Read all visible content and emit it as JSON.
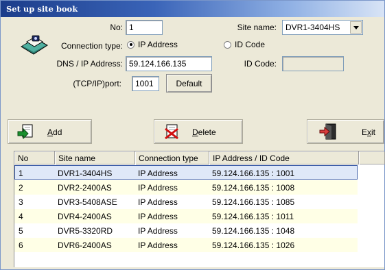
{
  "window": {
    "title": "Set up site book"
  },
  "form": {
    "no_label": "No:",
    "no_value": "1",
    "site_name_label": "Site name:",
    "site_name_value": "DVR1-3404HS",
    "connection_type_label": "Connection type:",
    "radio_ip_label": "IP Address",
    "radio_id_label": "ID Code",
    "selected_connection": "IP Address",
    "dns_ip_label": "DNS / IP Address:",
    "dns_ip_value": "59.124.166.135",
    "id_code_label": "ID Code:",
    "id_code_value": "",
    "port_label": "(TCP/IP)port:",
    "port_value": "1001",
    "default_button": "Default"
  },
  "toolbar": {
    "add_label": "Add",
    "add_accel": "A",
    "delete_label": "Delete",
    "delete_accel": "D",
    "exit_label": "Exit",
    "exit_accel": "x",
    "icons": [
      "add-icon",
      "delete-icon",
      "exit-icon"
    ]
  },
  "table": {
    "columns": [
      "No",
      "Site name",
      "Connection type",
      "IP Address / ID Code"
    ],
    "rows": [
      {
        "no": "1",
        "site": "DVR1-3404HS",
        "conn": "IP Address",
        "addr": "59.124.166.135 : 1001"
      },
      {
        "no": "2",
        "site": "DVR2-2400AS",
        "conn": "IP Address",
        "addr": "59.124.166.135 : 1008"
      },
      {
        "no": "3",
        "site": "DVR3-5408ASE",
        "conn": "IP Address",
        "addr": "59.124.166.135 : 1085"
      },
      {
        "no": "4",
        "site": "DVR4-2400AS",
        "conn": "IP Address",
        "addr": "59.124.166.135 : 1011"
      },
      {
        "no": "5",
        "site": "DVR5-3320RD",
        "conn": "IP Address",
        "addr": "59.124.166.135 : 1048"
      },
      {
        "no": "6",
        "site": "DVR6-2400AS",
        "conn": "IP Address",
        "addr": "59.124.166.135 : 1026"
      }
    ],
    "selected_row": 0
  },
  "colors": {
    "title_gradient_start": "#1c3d8a",
    "window_bg": "#ece9d8",
    "row_alt": "#ffffe6",
    "row_selected": "#dfe8f8"
  }
}
